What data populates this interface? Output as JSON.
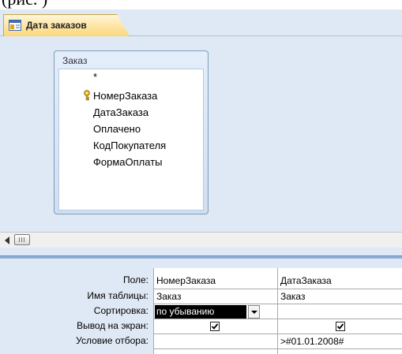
{
  "document": {
    "fragment": "(рис. )"
  },
  "tab": {
    "label": "Дата заказов",
    "icon": "query-design-icon"
  },
  "table": {
    "title": "Заказ",
    "fields": [
      "*",
      "НомерЗаказа",
      "ДатаЗаказа",
      "Оплачено",
      "КодПокупателя",
      "ФормаОплаты"
    ],
    "key_field": "НомерЗаказа",
    "key_icon": "primary-key-icon"
  },
  "qbe": {
    "row_labels": {
      "field": "Поле:",
      "table": "Имя таблицы:",
      "sort": "Сортировка:",
      "show": "Вывод на экран:",
      "criteria": "Условие отбора:"
    },
    "columns": [
      {
        "field": "НомерЗаказа",
        "table": "Заказ",
        "sort": "по убыванию",
        "show": true,
        "criteria": ""
      },
      {
        "field": "ДатаЗаказа",
        "table": "Заказ",
        "sort": "",
        "show": true,
        "criteria": ">#01.01.2008#"
      }
    ]
  },
  "colors": {
    "pane_background": "#dfe9f5",
    "tab_gradient_top": "#fff6d6",
    "tab_gradient_bottom": "#fbd67a",
    "table_border": "#7f9db9",
    "selection": "#000000"
  }
}
